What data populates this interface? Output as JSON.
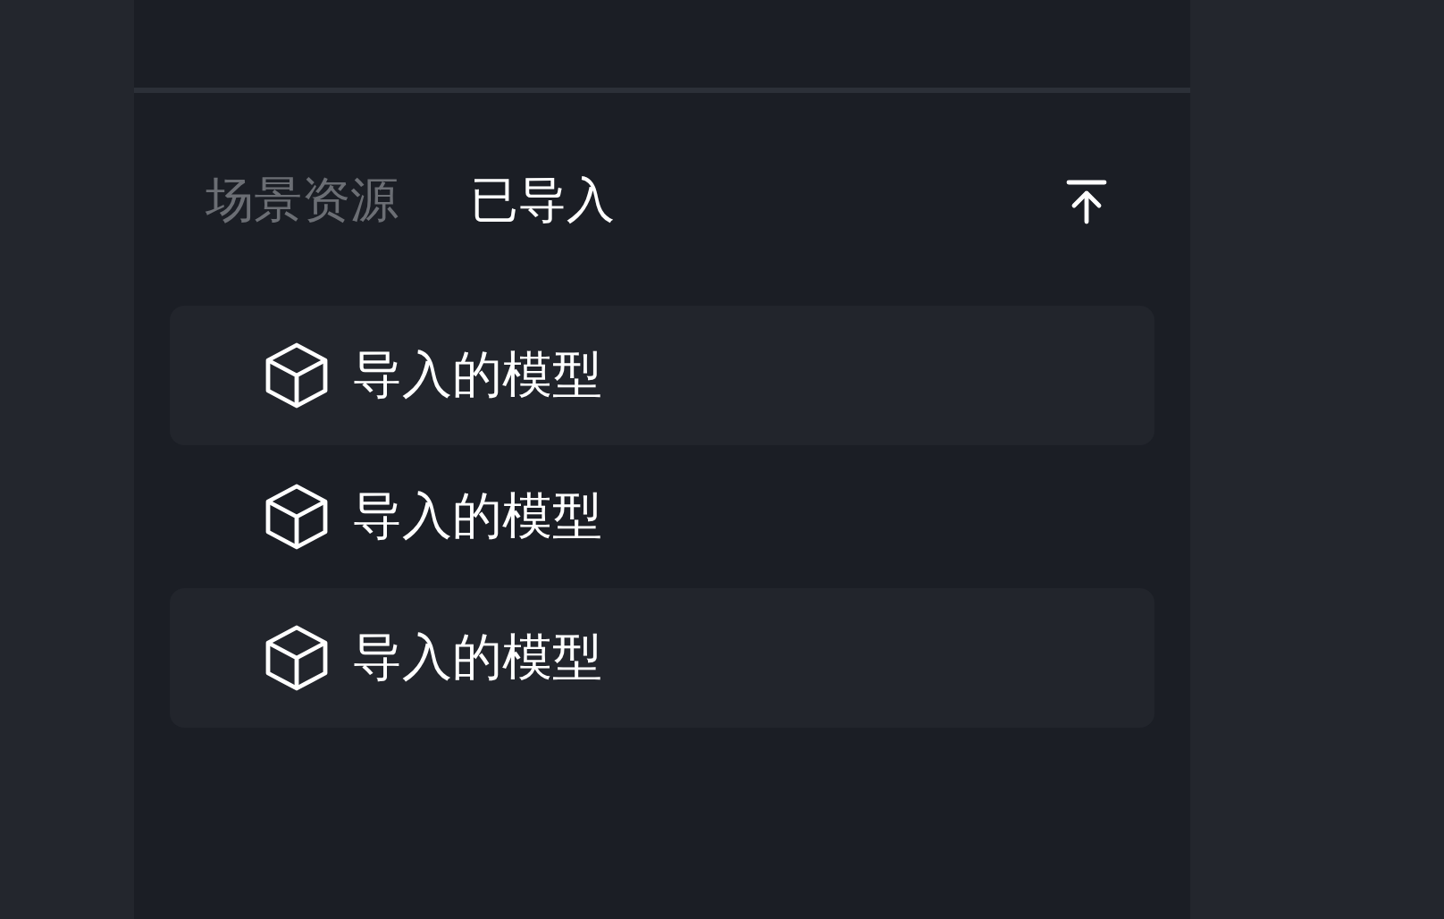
{
  "tabs": [
    {
      "label": "场景资源",
      "selected": false
    },
    {
      "label": "已导入",
      "selected": true
    }
  ],
  "items": [
    {
      "label": "导入的模型"
    },
    {
      "label": "导入的模型"
    },
    {
      "label": "导入的模型"
    }
  ]
}
